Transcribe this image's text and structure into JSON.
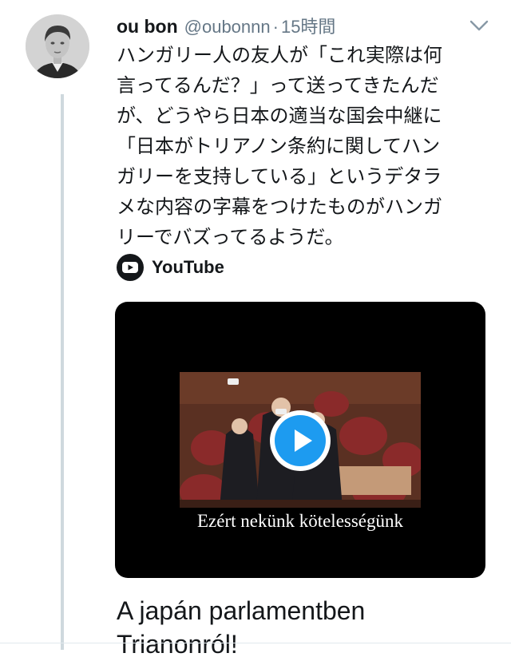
{
  "tweet": {
    "author_name": "ou bon",
    "handle": "@oubonnn",
    "separator": "·",
    "time": "15時間",
    "text_lines": [
      "ハンガリー人の友人が「これ実際は何",
      "言ってるんだ？」って送ってきたんだ",
      "が、どうやら日本の適当な国会中継に",
      "「日本がトリアノン条約に関してハン",
      "ガリーを支持している」というデタラ",
      "メな内容の字幕をつけたものがハンガ",
      "リーでバズってるようだ。"
    ]
  },
  "card": {
    "source": "YouTube",
    "video_subtitle": "Ezért nekünk kötelességünk",
    "title_lines": [
      "A japán parlamentben",
      "Trianonról!"
    ]
  },
  "colors": {
    "text": "#14171a",
    "secondary": "#657786",
    "thread_line": "#cfd9de",
    "play_button": "#1d9bf0",
    "card_bg": "#000000"
  }
}
